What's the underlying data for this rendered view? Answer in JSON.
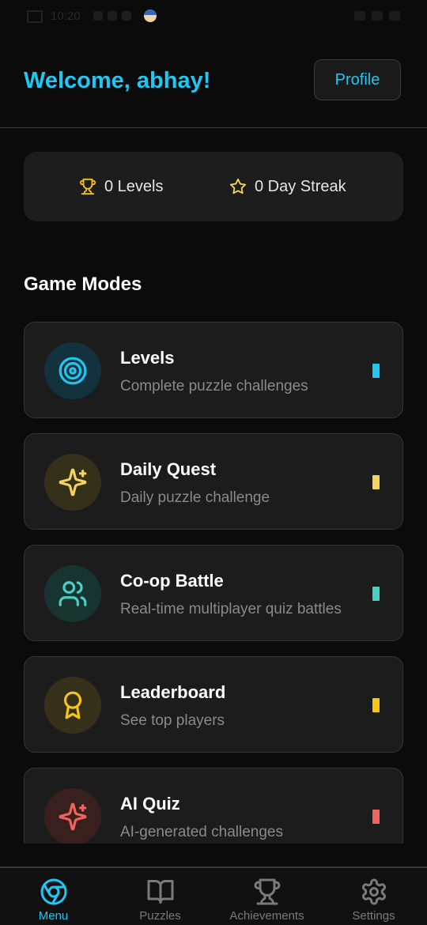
{
  "status_bar": {
    "time": "10:20"
  },
  "header": {
    "welcome": "Welcome, abhay!",
    "profile_label": "Profile"
  },
  "stats": {
    "levels": "0 Levels",
    "streak": "0 Day Streak"
  },
  "section_title": "Game Modes",
  "modes": [
    {
      "title": "Levels",
      "subtitle": "Complete puzzle challenges",
      "icon": "target-icon",
      "accent": "#1fc7f2",
      "icon_bg": "#12333d"
    },
    {
      "title": "Daily Quest",
      "subtitle": "Daily puzzle challenge",
      "icon": "sparkles-icon",
      "accent": "#f4d35e",
      "icon_bg": "#35301a"
    },
    {
      "title": "Co-op Battle",
      "subtitle": "Real-time multiplayer quiz battles",
      "icon": "users-icon",
      "accent": "#4ecdc4",
      "icon_bg": "#173431"
    },
    {
      "title": "Leaderboard",
      "subtitle": "See top players",
      "icon": "award-icon",
      "accent": "#f5c518",
      "icon_bg": "#36301a"
    },
    {
      "title": "AI Quiz",
      "subtitle": "AI-generated challenges",
      "icon": "sparkles-icon",
      "accent": "#f0645f",
      "icon_bg": "#3a1f1f"
    }
  ],
  "nav": [
    {
      "label": "Menu",
      "icon": "chrome-icon",
      "active": true
    },
    {
      "label": "Puzzles",
      "icon": "book-open-icon",
      "active": false
    },
    {
      "label": "Achievements",
      "icon": "trophy-icon",
      "active": false
    },
    {
      "label": "Settings",
      "icon": "gear-icon",
      "active": false
    }
  ],
  "colors": {
    "accent": "#1fc7f2",
    "background": "#0b0b0b",
    "card": "#1c1c1c",
    "star": "#f4d35e"
  }
}
